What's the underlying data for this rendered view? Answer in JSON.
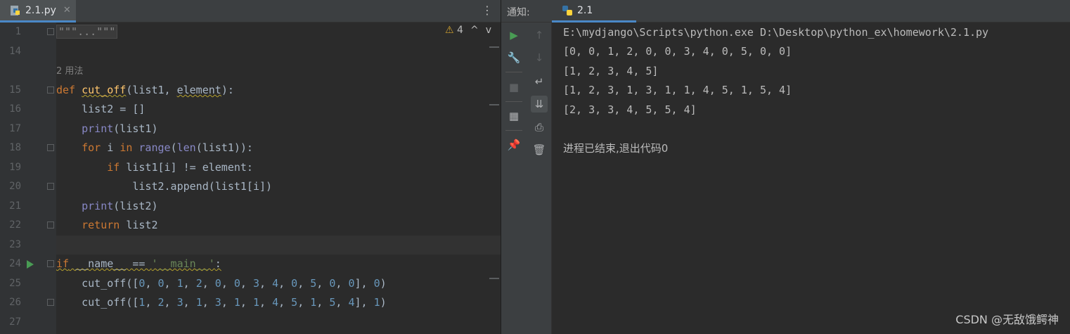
{
  "editor": {
    "tab": {
      "filename": "2.1.py",
      "close_glyph": "✕"
    },
    "menu_glyph": "⋮",
    "inspection": {
      "warning_count": "4",
      "up": "^",
      "down": "v"
    },
    "usage_hint": "2 用法",
    "lines": [
      {
        "no": "1",
        "text": "\"\"\"...\"\"\""
      },
      {
        "no": "14",
        "text": ""
      },
      {
        "no": "15",
        "text": "def cut_off(list1, element):"
      },
      {
        "no": "16",
        "text": "    list2 = []"
      },
      {
        "no": "17",
        "text": "    print(list1)"
      },
      {
        "no": "18",
        "text": "    for i in range(len(list1)):"
      },
      {
        "no": "19",
        "text": "        if list1[i] != element:"
      },
      {
        "no": "20",
        "text": "            list2.append(list1[i])"
      },
      {
        "no": "21",
        "text": "    print(list2)"
      },
      {
        "no": "22",
        "text": "    return list2"
      },
      {
        "no": "23",
        "text": ""
      },
      {
        "no": "24",
        "text": "if __name__ == '__main__':"
      },
      {
        "no": "25",
        "text": "    cut_off([0, 0, 1, 2, 0, 0, 3, 4, 0, 5, 0, 0], 0)"
      },
      {
        "no": "26",
        "text": "    cut_off([1, 2, 3, 1, 3, 1, 1, 4, 5, 1, 5, 4], 1)"
      },
      {
        "no": "27",
        "text": ""
      }
    ]
  },
  "run": {
    "title": "通知:",
    "tab_label": "2.1",
    "toolbar": {
      "rerun": "▶",
      "wrench": "🔧",
      "stop": "■",
      "layout": "▦",
      "pin": "📌",
      "up": "↑",
      "down": "↓",
      "wrap": "↵",
      "scroll_end": "⇊",
      "print": "⎙",
      "trash": "🗑"
    },
    "output": [
      "E:\\mydjango\\Scripts\\python.exe D:\\Desktop\\python_ex\\homework\\2.1.py",
      "[0, 0, 1, 2, 0, 0, 3, 4, 0, 5, 0, 0]",
      "[1, 2, 3, 4, 5]",
      "[1, 2, 3, 1, 3, 1, 1, 4, 5, 1, 5, 4]",
      "[2, 3, 3, 4, 5, 5, 4]",
      "",
      "进程已结束,退出代码0"
    ]
  },
  "watermark": "CSDN @无敌饿鳄神",
  "colors": {
    "keyword": "#cc7832",
    "function": "#ffc66d",
    "builtin": "#8888c6",
    "number": "#6897bb",
    "string": "#6a8759",
    "run_green": "#499c54",
    "tab_accent": "#4a88c7"
  }
}
